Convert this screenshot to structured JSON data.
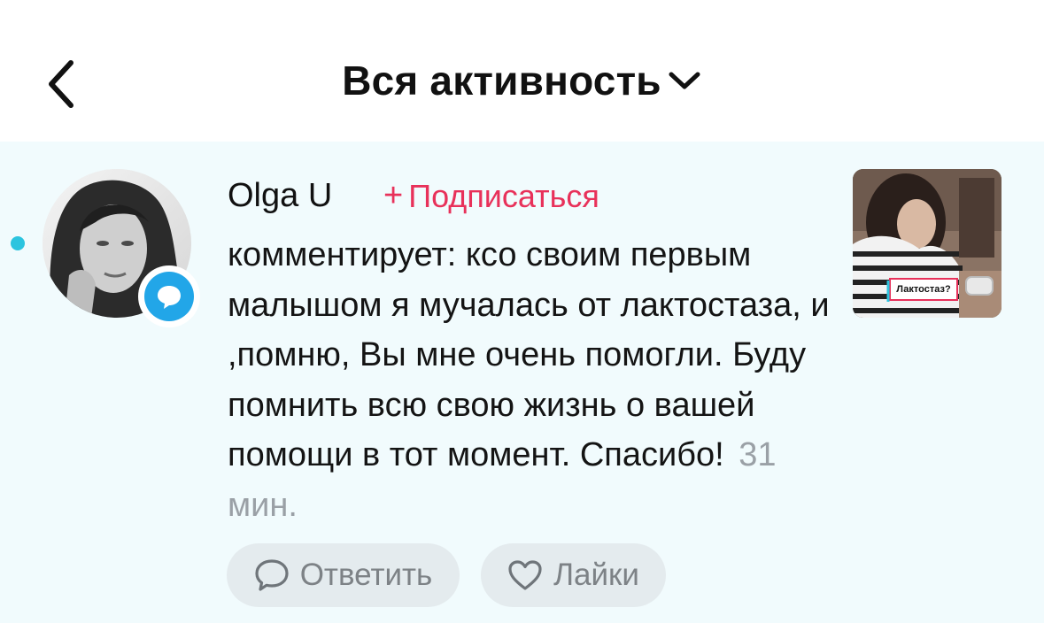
{
  "header": {
    "back_icon": "chevron-left-icon",
    "title": "Вся активность",
    "dropdown_icon": "chevron-down-icon"
  },
  "notification": {
    "unread": true,
    "user_name": "Olga U",
    "follow_label": "Подписаться",
    "follow_prefix": "+",
    "badge_icon": "comment-bubble-icon",
    "comment_text": "комментирует: ксо своим первым малышом я мучалась от лактостаза, и ,помню, Вы мне очень помогли. Буду помнить всю свою жизнь о вашей помощи в тот момент. Спасибо!",
    "time": "31 мин.",
    "thumbnail_caption": "Лактостаз?",
    "reply_label": "Ответить",
    "reply_icon": "speech-bubble-icon",
    "like_label": "Лайки",
    "like_icon": "heart-outline-icon"
  },
  "colors": {
    "accent": "#e8315a",
    "unread_dot": "#2cc4df",
    "badge": "#22a6e8",
    "row_background": "#f1fbfd",
    "pill_background": "#e4ebee"
  }
}
